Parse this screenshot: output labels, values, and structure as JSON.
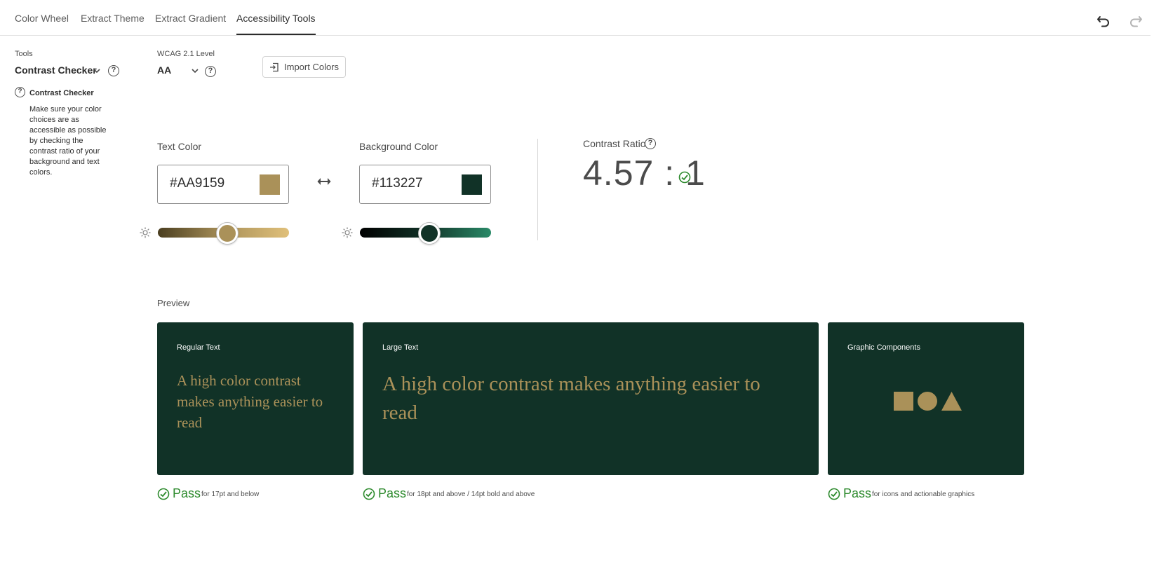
{
  "tabs": [
    {
      "label": "Color Wheel"
    },
    {
      "label": "Extract Theme"
    },
    {
      "label": "Extract Gradient"
    },
    {
      "label": "Accessibility Tools"
    }
  ],
  "tools": {
    "label": "Tools",
    "value": "Contrast Checker",
    "info_title": "Contrast Checker",
    "info_text": "Make sure your color choices are as accessible as possible by checking the contrast ratio of your background and text colors."
  },
  "wcag": {
    "label": "WCAG 2.1 Level",
    "value": "AA"
  },
  "import_button": "Import Colors",
  "text_color": {
    "label": "Text Color",
    "hex": "#AA9159",
    "color": "#AA9159",
    "brightness": 0.53
  },
  "background_color": {
    "label": "Background Color",
    "hex": "#113227",
    "color": "#113227",
    "brightness": 0.53
  },
  "contrast": {
    "label": "Contrast Ratio",
    "value": "4.57 : 1"
  },
  "preview": {
    "label": "Preview",
    "regular": {
      "title": "Regular Text",
      "sample": "A high color contrast makes anything easier to read",
      "status": "Pass",
      "note": "for 17pt and below"
    },
    "large": {
      "title": "Large Text",
      "sample": "A high color contrast makes anything easier to read",
      "status": "Pass",
      "note": "for 18pt and above / 14pt bold and above"
    },
    "graphic": {
      "title": "Graphic Components",
      "status": "Pass",
      "note": "for icons and actionable graphics"
    }
  },
  "colors": {
    "pass_green": "#2d8a2d",
    "card_bg": "#113227",
    "accent": "#AA9159"
  },
  "icons": [
    "undo-icon",
    "redo-icon",
    "chevron-down-icon",
    "help-icon",
    "import-icon",
    "swap-icon",
    "brightness-icon",
    "check-circle-icon"
  ]
}
